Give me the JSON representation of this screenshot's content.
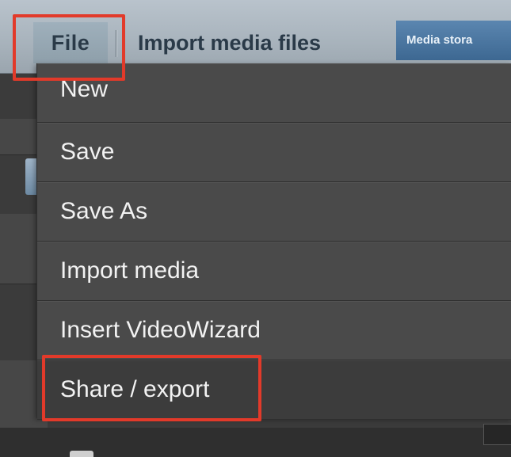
{
  "menubar": {
    "file_label": "File",
    "import_label": "Import media files",
    "media_tab_label": "Media stora"
  },
  "dropdown": {
    "items": [
      {
        "label": "New"
      },
      {
        "label": "Save"
      },
      {
        "label": "Save As"
      },
      {
        "label": "Import media"
      },
      {
        "label": "Insert VideoWizard"
      },
      {
        "label": "Share / export"
      }
    ],
    "selected_index": 5
  },
  "highlights": {
    "color": "#e23a2a",
    "targets": [
      "file-menu",
      "share-export-item"
    ]
  }
}
